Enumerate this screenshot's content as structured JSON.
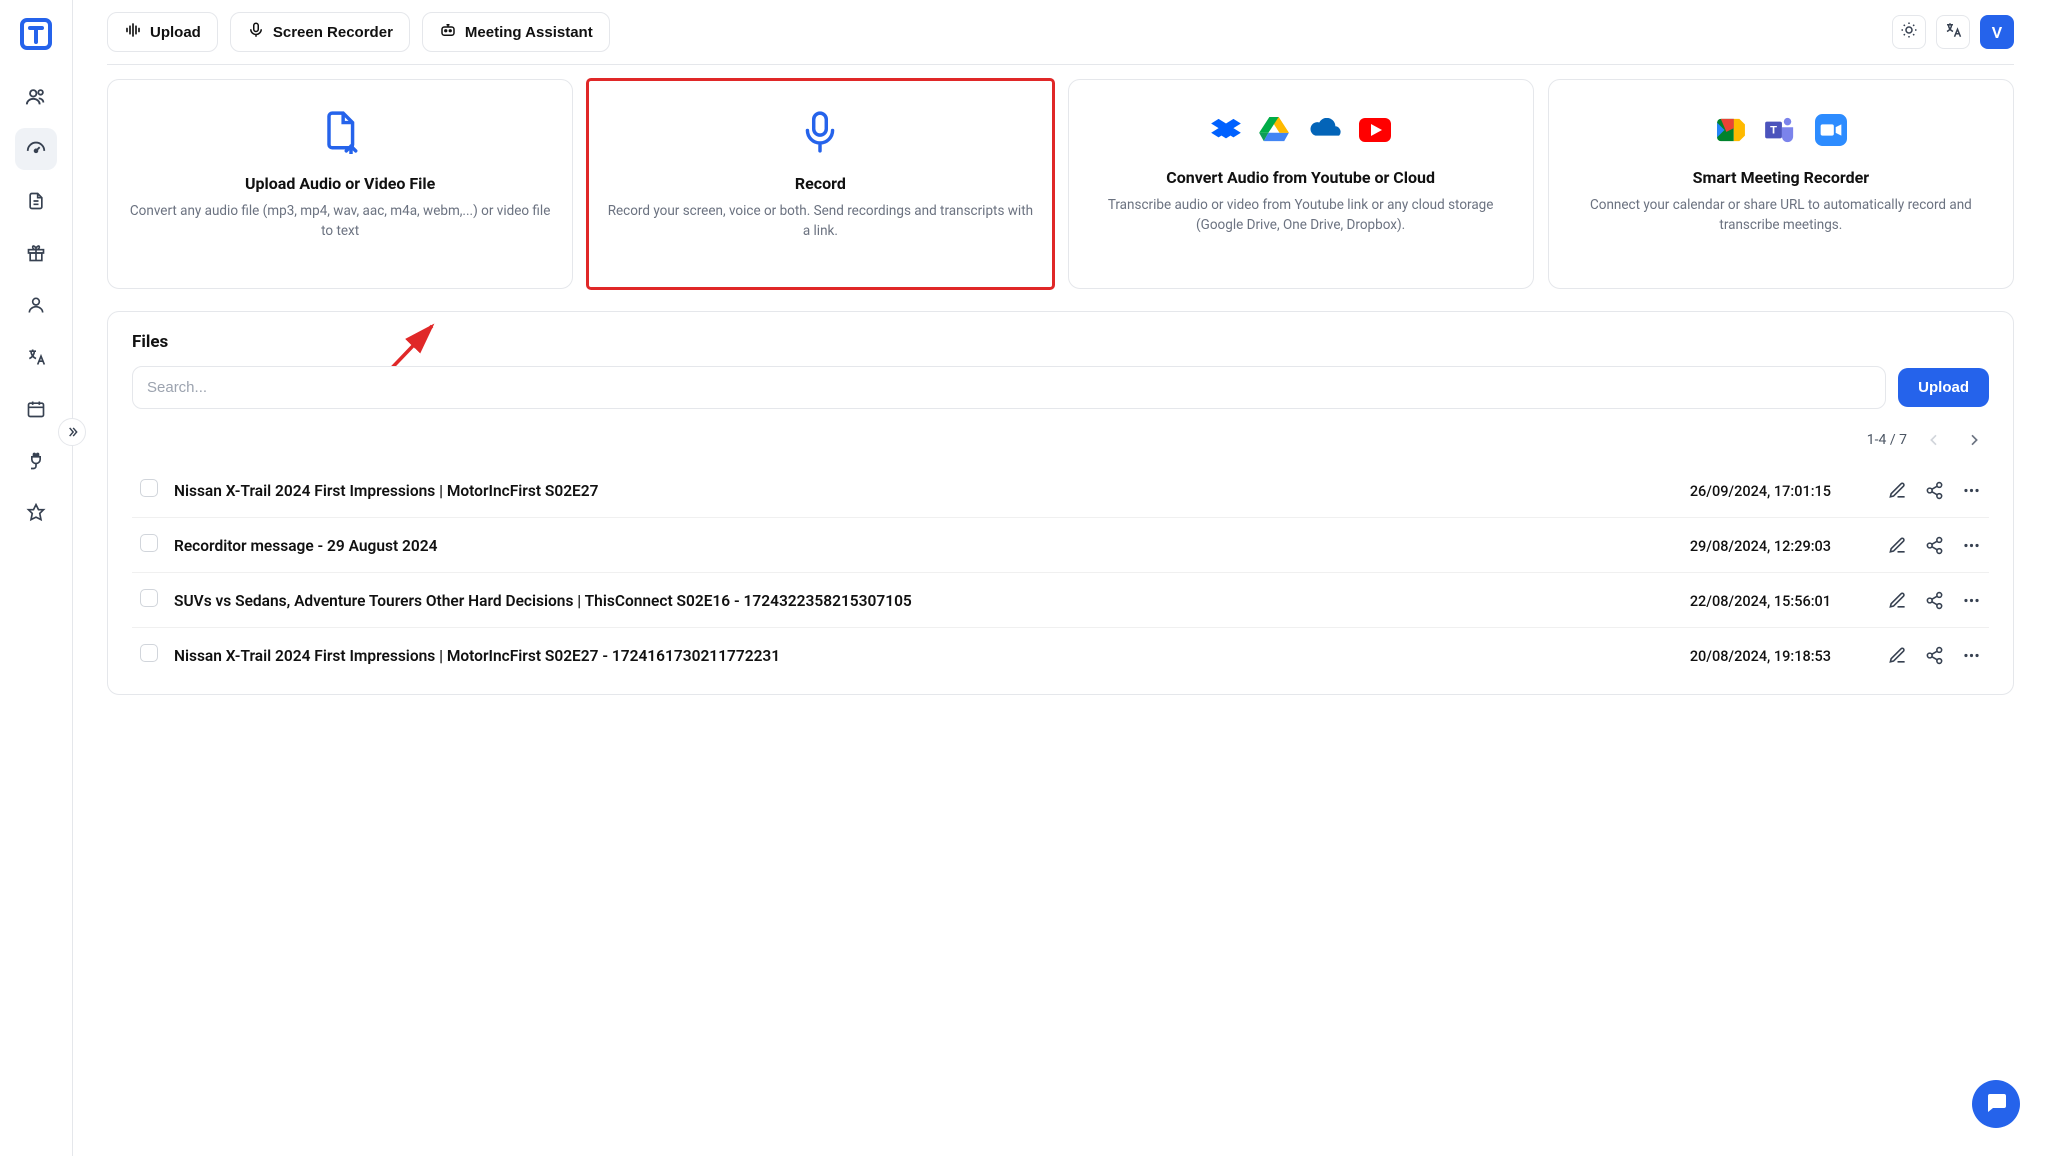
{
  "topbar": {
    "upload_label": "Upload",
    "screen_recorder_label": "Screen Recorder",
    "meeting_assistant_label": "Meeting Assistant",
    "avatar_letter": "V"
  },
  "cards": [
    {
      "title": "Upload Audio or Video File",
      "desc": "Convert any audio file (mp3, mp4, wav, aac, m4a, webm,...) or video file to text"
    },
    {
      "title": "Record",
      "desc": "Record your screen, voice or both. Send recordings and transcripts with a link."
    },
    {
      "title": "Convert Audio from Youtube or Cloud",
      "desc": "Transcribe audio or video from Youtube link or any cloud storage (Google Drive, One Drive, Dropbox)."
    },
    {
      "title": "Smart Meeting Recorder",
      "desc": "Connect your calendar or share URL to automatically record and transcribe meetings."
    }
  ],
  "files": {
    "section_title": "Files",
    "search_placeholder": "Search...",
    "upload_button": "Upload",
    "pager": "1-4 / 7",
    "rows": [
      {
        "name": "Nissan X-Trail 2024 First Impressions | MotorIncFirst S02E27",
        "date": "26/09/2024, 17:01:15"
      },
      {
        "name": "Recorditor message - 29 August 2024",
        "date": "29/08/2024, 12:29:03"
      },
      {
        "name": "SUVs vs Sedans, Adventure Tourers Other Hard Decisions | ThisConnect S02E16 - 1724322358215307105",
        "date": "22/08/2024, 15:56:01"
      },
      {
        "name": "Nissan X-Trail 2024 First Impressions | MotorIncFirst S02E27 - 1724161730211772231",
        "date": "20/08/2024, 19:18:53"
      }
    ]
  }
}
